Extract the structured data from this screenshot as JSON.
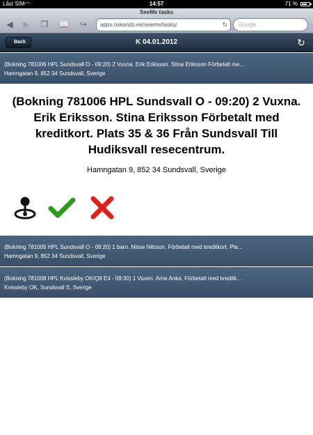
{
  "status_bar": {
    "carrier": "Låst SIM",
    "time": "14:57",
    "battery": "71 %",
    "battery_level": 0.71
  },
  "browser": {
    "page_title": "SeeMe tasks",
    "url": "apps.oskando.ee/seeme/tasks/",
    "search_placeholder": "Google"
  },
  "header": {
    "back_label": "Back",
    "title": "K 04.01.2012"
  },
  "tasks": [
    {
      "line1": "(Bokning 781006 HPL Sundsvall O - 09:20) 2 Vuxna. Erik Eriksson. Stina Eriksson Förbetalt me...",
      "line2": "Hamngatan 9, 852 34 Sundsvall, Sverige"
    },
    {
      "line1": "(Bokning 781005 HPL Sundsvall O - 09:20) 1 barn. Nisse Nilsson. Förbetalt med kreditkort. Pla...",
      "line2": "Hamngatan 9, 852 34 Sundsvall, Sverige"
    },
    {
      "line1": "(Bokning 781008 HPL Kvissleby OK/Q8 E4 - 09:30) 1 Vuxen. Arne Anka. Förbetalt med kreditk...",
      "line2": "Kvissleby OK, Sundsvall S, Sverige"
    }
  ],
  "detail": {
    "title": "(Bokning 781006 HPL Sundsvall O - 09:20) 2 Vuxna. Erik Eriksson. Stina Eriksson Förbetalt med kreditkort. Plats 35 & 36 Från Sundsvall Till Hudiksvall resecentrum.",
    "address": "Hamngatan 9, 852 34 Sundsvall, Sverige",
    "actions": [
      {
        "icon": "joystick-icon"
      },
      {
        "icon": "checkmark-icon",
        "color": "#2e9a1e"
      },
      {
        "icon": "cross-icon",
        "color": "#e0201b"
      }
    ]
  }
}
